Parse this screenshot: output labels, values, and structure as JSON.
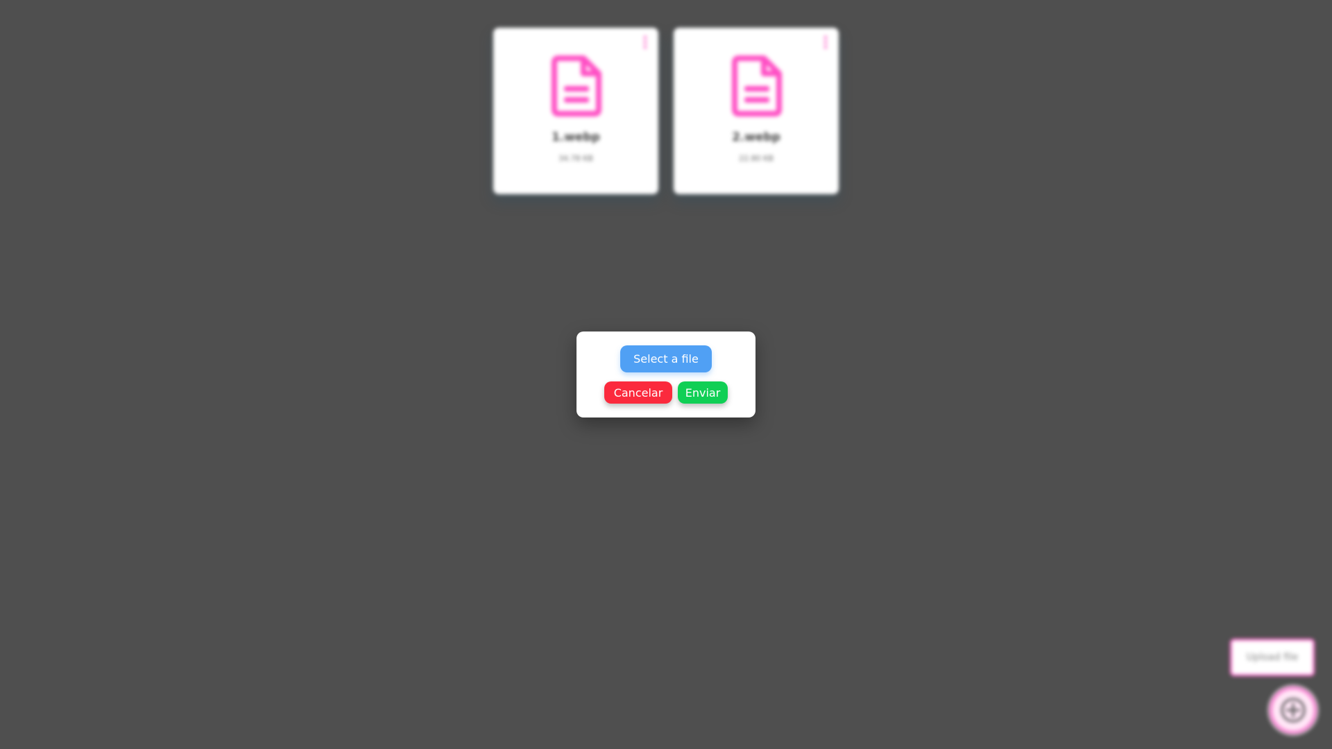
{
  "files": [
    {
      "name": "1.webp",
      "size": "34.78 KB"
    },
    {
      "name": "2.webp",
      "size": "22.80 KB"
    }
  ],
  "upload_tooltip": "Upload file",
  "modal": {
    "select_label": "Select a file",
    "cancel_label": "Cancelar",
    "send_label": "Enviar"
  },
  "colors": {
    "background": "#4f4f4f",
    "accent_pink": "#ff4ec4",
    "select_blue": "#50a0f4",
    "cancel_red": "#fb2a3d",
    "send_green": "#10cf55"
  },
  "icons": {
    "file": "document-icon",
    "menu": "kebab-menu-icon",
    "add": "plus-circle-icon"
  }
}
